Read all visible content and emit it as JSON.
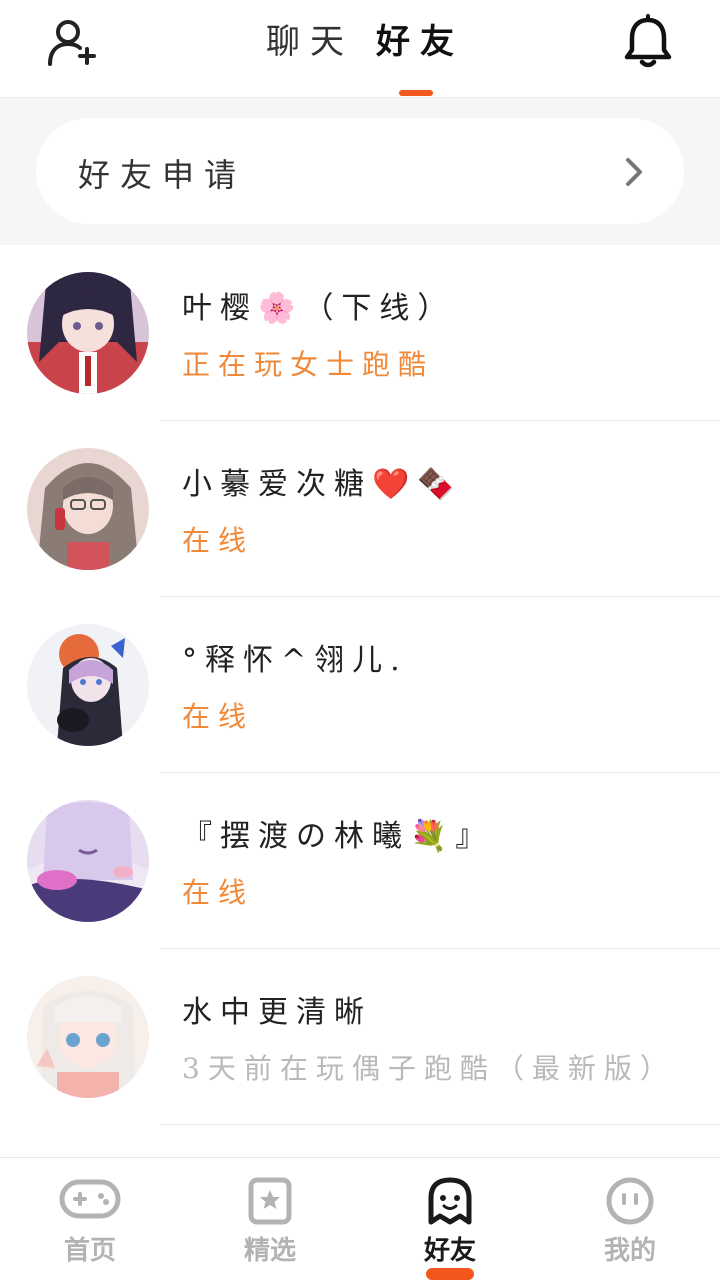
{
  "header": {
    "tabs": [
      {
        "label": "聊天",
        "active": false
      },
      {
        "label": "好友",
        "active": true
      }
    ],
    "accent_color": "#f2571b",
    "left_icon": "add-friend-icon",
    "right_icon": "bell-icon"
  },
  "friend_request": {
    "label": "好友申请",
    "icon": "chevron-right-icon"
  },
  "friends": [
    {
      "name": "叶樱🌸（下线）",
      "status": "正在玩女士跑酷",
      "online": true
    },
    {
      "name": "小繤爱次糖❤️🍫",
      "status": "在线",
      "online": true
    },
    {
      "name": "°释怀^翎儿.",
      "status": "在线",
      "online": true
    },
    {
      "name": "『摆渡の林曦💐』",
      "status": "在线",
      "online": true
    },
    {
      "name": "水中更清晰",
      "status": "3天前在玩偶子跑酷（最新版）",
      "online": false
    }
  ],
  "bottom_nav": [
    {
      "label": "首页",
      "icon": "gamepad-icon",
      "active": false
    },
    {
      "label": "精选",
      "icon": "star-card-icon",
      "active": false
    },
    {
      "label": "好友",
      "icon": "ghost-icon",
      "active": true
    },
    {
      "label": "我的",
      "icon": "face-icon",
      "active": false
    }
  ],
  "colors": {
    "online_status": "#f08a3a",
    "offline_status": "#b9b9b9",
    "inactive_nav": "#b3b3b3"
  }
}
